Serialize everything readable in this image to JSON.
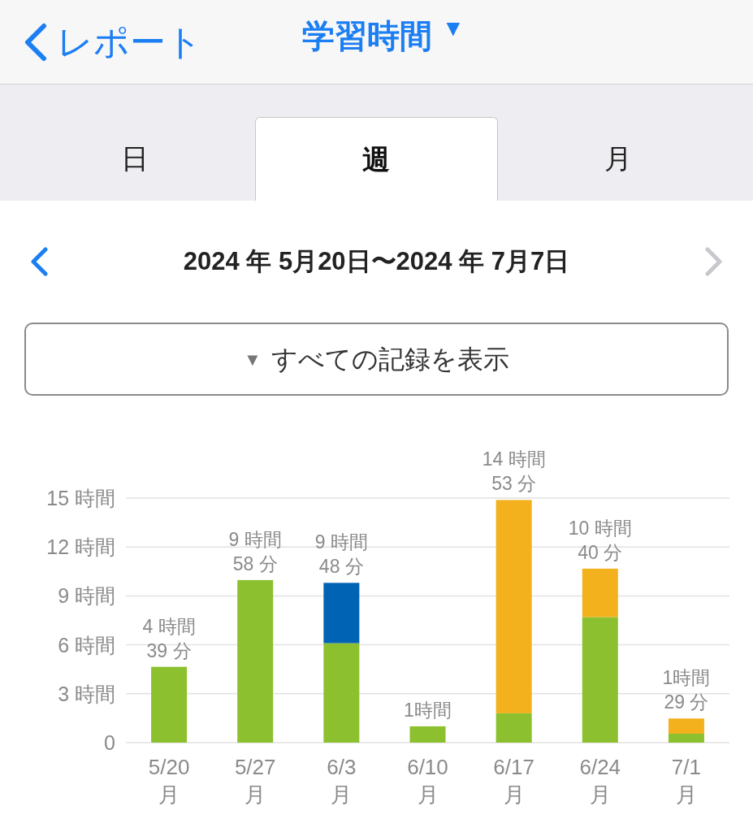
{
  "nav_bar": {
    "back_label": "レポート",
    "title": "学習時間",
    "title_caret": "▼"
  },
  "tabs": [
    {
      "label": "日",
      "selected": false
    },
    {
      "label": "週",
      "selected": true
    },
    {
      "label": "月",
      "selected": false
    }
  ],
  "date_range": {
    "text": "2024 年 5月20日〜2024 年 7月7日",
    "prev_disabled": false,
    "next_disabled": true
  },
  "filter_button": {
    "caret": "▼",
    "label": "すべての記録を表示"
  },
  "chart_data": {
    "type": "bar",
    "stacked": true,
    "orientation": "vertical",
    "categories": [
      "5/20 月",
      "5/27 月",
      "6/3 月",
      "6/10 月",
      "6/17 月",
      "6/24 月",
      "7/1 月"
    ],
    "series": [
      {
        "color": "#8dc02e",
        "values": [
          4.65,
          9.97,
          6.1,
          1,
          1.8,
          7.7,
          0.55
        ]
      },
      {
        "color": "#0063b4",
        "values": [
          0,
          0,
          3.7,
          0,
          0,
          0,
          0
        ]
      },
      {
        "color": "#f2b11d",
        "values": [
          0,
          0,
          0,
          0,
          13.08,
          2.97,
          0.93
        ]
      }
    ],
    "ylim": [
      0,
      15
    ],
    "grid": true,
    "yticks": [
      {
        "value": 0,
        "label": "0"
      },
      {
        "value": 3,
        "label": "3 時間"
      },
      {
        "value": 6,
        "label": "6 時間"
      },
      {
        "value": 9,
        "label": "9 時間"
      },
      {
        "value": 12,
        "label": "12 時間"
      },
      {
        "value": 15,
        "label": "15 時間"
      }
    ],
    "value_labels": [
      "4 時間\n39 分",
      "9 時間\n58 分",
      "9 時間\n48 分",
      "1時間",
      "14 時間\n53 分",
      "10 時間\n40 分",
      "1時間\n29 分"
    ]
  }
}
